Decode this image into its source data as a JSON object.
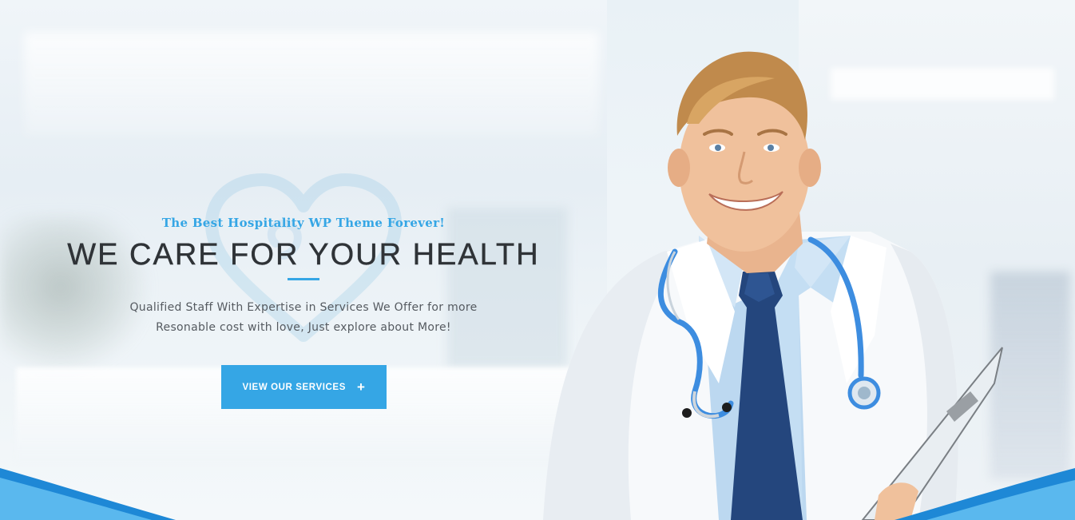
{
  "hero": {
    "tagline": "The Best Hospitality WP Theme Forever!",
    "headline": "WE CARE FOR YOUR HEALTH",
    "description_line1": "Qualified Staff With Expertise in Services We Offer for more",
    "description_line2": "Resonable cost with love, Just explore about More!",
    "cta_label": "VIEW OUR SERVICES",
    "cta_icon": "plus-icon",
    "image_icon": "doctor-photo",
    "watermark_icon": "heart-icon"
  },
  "colors": {
    "accent": "#35a6e5",
    "heading": "#2f3337",
    "body_text": "#555a60",
    "wave_dark": "#1e88d6",
    "wave_light": "#5ab8ee"
  }
}
